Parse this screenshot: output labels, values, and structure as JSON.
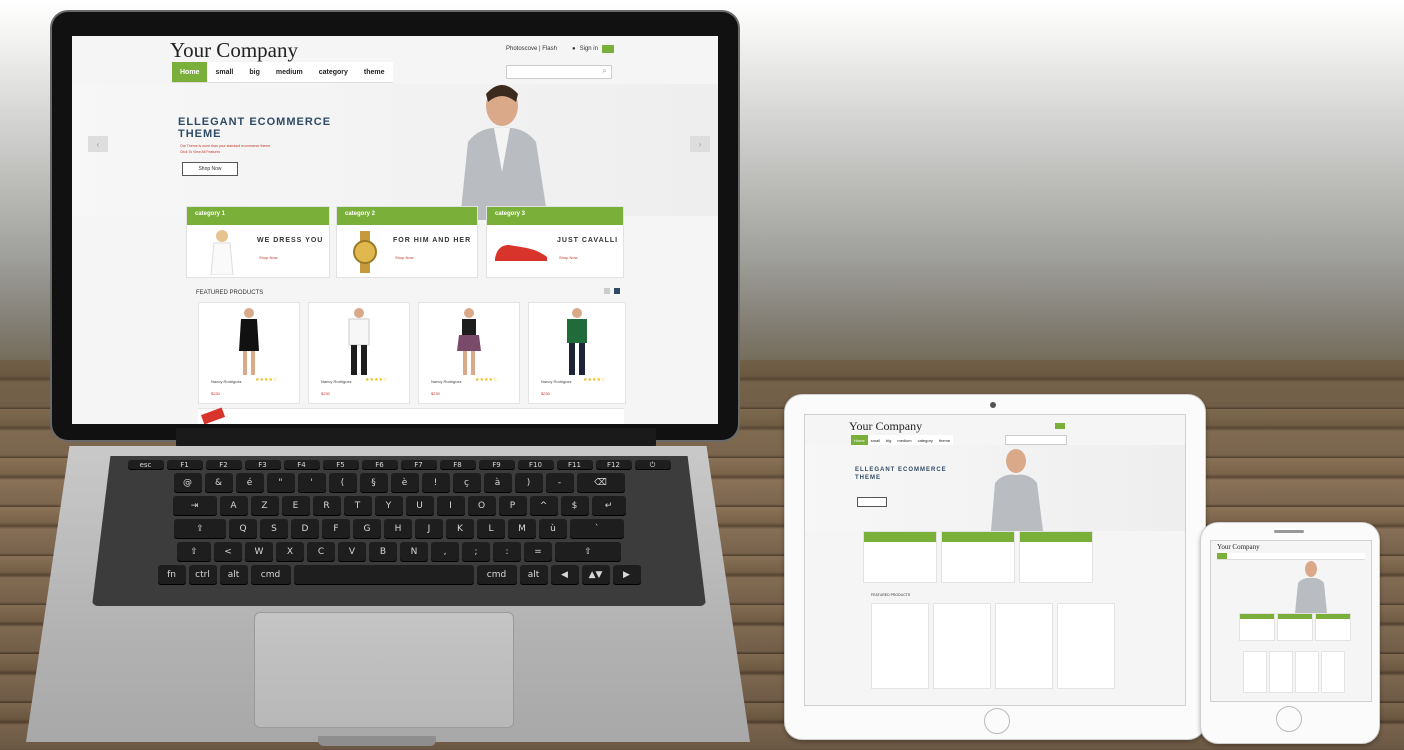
{
  "site": {
    "logo": "Your Company",
    "top_links": "Photoscove | Flash",
    "sign_in": "Sign in",
    "nav": [
      "Home",
      "small",
      "big",
      "medium",
      "category",
      "theme"
    ],
    "hero": {
      "title_line1": "ELLEGANT ECOMMERCE",
      "title_line2": "THEME",
      "sub_line1": "Our Theme is more than your standard ecommerce theme",
      "sub_line2": "Click To View All Features",
      "button": "Shop Now"
    },
    "categories": [
      {
        "header": "category 1",
        "title": "WE DRESS YOU",
        "link": "Shop Now"
      },
      {
        "header": "category 2",
        "title": "FOR HIM AND HER",
        "link": "Shop Now"
      },
      {
        "header": "category 3",
        "title": "JUST CAVALLI",
        "link": "Shop Now"
      }
    ],
    "featured_label": "FEATURED PRODUCTS",
    "products": [
      {
        "name": "Nancy Rodriguez",
        "rating": "★★★★☆",
        "price": "$230"
      },
      {
        "name": "Nancy Rodriguez",
        "rating": "★★★★☆",
        "price": "$230"
      },
      {
        "name": "Nancy Rodriguez",
        "rating": "★★★★☆",
        "price": "$230"
      },
      {
        "name": "Nancy Rodriguez",
        "rating": "★★★★☆",
        "price": "$230"
      }
    ]
  },
  "tablet": {
    "logo": "Your Company",
    "hero_title_line1": "ELLEGANT ECOMMERCE",
    "hero_title_line2": "THEME",
    "featured_label": "FEATURED PRODUCTS"
  },
  "phone": {
    "logo": "Your Company"
  },
  "keyboard": {
    "row1": [
      "esc",
      "F1",
      "F2",
      "F3",
      "F4",
      "F5",
      "F6",
      "F7",
      "F8",
      "F9",
      "F10",
      "F11",
      "F12",
      "⏻"
    ],
    "row2": [
      "@",
      "&",
      "é",
      "\"",
      "'",
      "(",
      "§",
      "è",
      "!",
      "ç",
      "à",
      ")",
      "-",
      "⌫"
    ],
    "row3": [
      "⇥",
      "A",
      "Z",
      "E",
      "R",
      "T",
      "Y",
      "U",
      "I",
      "O",
      "P",
      "^",
      "$",
      "↵"
    ],
    "row4": [
      "⇪",
      "Q",
      "S",
      "D",
      "F",
      "G",
      "H",
      "J",
      "K",
      "L",
      "M",
      "ù",
      "`"
    ],
    "row5": [
      "⇧",
      "<",
      "W",
      "X",
      "C",
      "V",
      "B",
      "N",
      ",",
      ";",
      ":",
      "=",
      "⇧"
    ],
    "row6": [
      "fn",
      "ctrl",
      "alt",
      "cmd",
      "",
      "cmd",
      "alt",
      "◀",
      "▲▼",
      "▶"
    ]
  },
  "colors": {
    "accent": "#7ab03a",
    "link": "#c0392b",
    "hero_title": "#2f4a64"
  }
}
